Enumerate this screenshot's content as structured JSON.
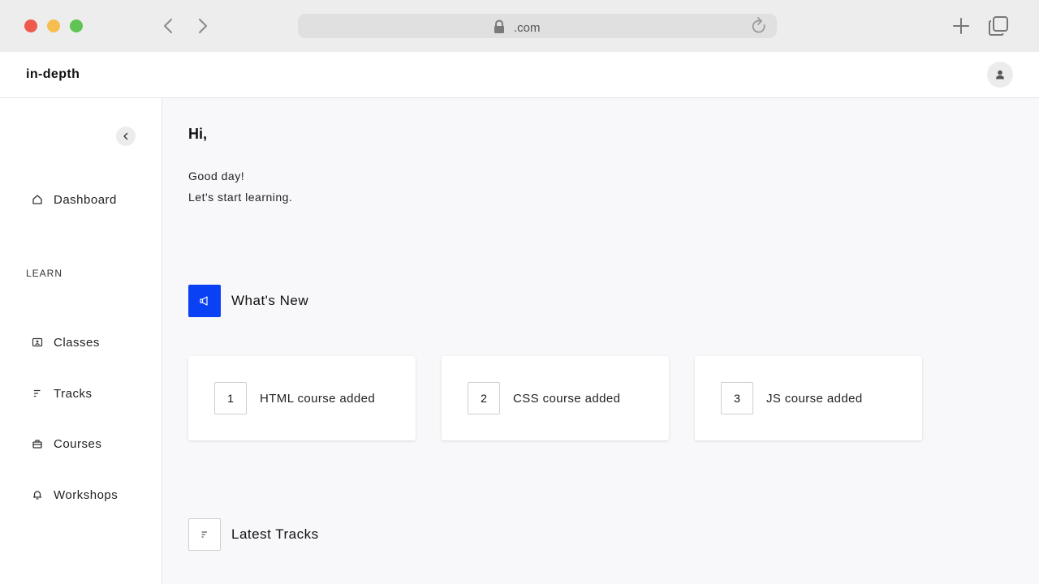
{
  "browser": {
    "url": ".com",
    "icons": {
      "back": "chevron-left-icon",
      "forward": "chevron-right-icon",
      "lock": "lock-icon",
      "reload": "reload-icon",
      "new_tab": "plus-icon",
      "tabs": "tabs-icon"
    }
  },
  "header": {
    "brand": "in-depth",
    "avatar_icon": "user-icon"
  },
  "sidebar": {
    "collapse_icon": "chevron-left-icon",
    "dashboard": {
      "label": "Dashboard",
      "icon": "home-icon"
    },
    "section_heading": "LEARN",
    "items": [
      {
        "label": "Classes",
        "icon": "classroom-icon"
      },
      {
        "label": "Tracks",
        "icon": "tracks-icon"
      },
      {
        "label": "Courses",
        "icon": "briefcase-icon"
      },
      {
        "label": "Workshops",
        "icon": "bell-icon"
      }
    ]
  },
  "main": {
    "greeting": "Hi,",
    "subtitle_1": "Good day!",
    "subtitle_2": "Let's start learning.",
    "whats_new": {
      "title": "What's New",
      "icon": "megaphone-icon",
      "accent": "#0a41f5",
      "cards": [
        {
          "number": "1",
          "text": "HTML course added"
        },
        {
          "number": "2",
          "text": "CSS course added"
        },
        {
          "number": "3",
          "text": "JS course added"
        }
      ]
    },
    "latest_tracks": {
      "title": "Latest Tracks",
      "icon": "tracks-icon"
    }
  }
}
